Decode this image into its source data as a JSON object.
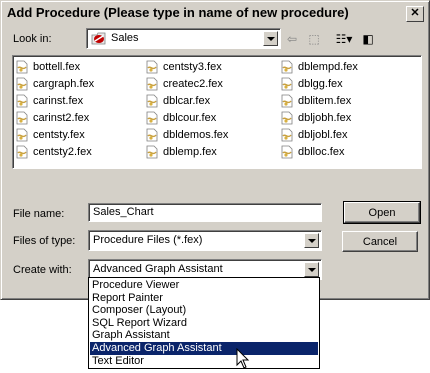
{
  "window": {
    "title": "Add Procedure (Please type in name of new procedure)",
    "close_symbol": "✕"
  },
  "look_in": {
    "label": "Look in:",
    "value": "Sales"
  },
  "toolbar": {
    "back_symbol": "⇦",
    "up_symbol": "⬚",
    "view_symbol": "☷▾",
    "detail_symbol": "◧"
  },
  "files": [
    "bottell.fex",
    "cargraph.fex",
    "carinst.fex",
    "carinst2.fex",
    "centsty.fex",
    "centsty2.fex",
    "centsty3.fex",
    "createc2.fex",
    "dblcar.fex",
    "dblcour.fex",
    "dbldemos.fex",
    "dblemp.fex",
    "dblempd.fex",
    "dblgg.fex",
    "dblitem.fex",
    "dbljobh.fex",
    "dbljobl.fex",
    "dblloc.fex"
  ],
  "file_name": {
    "label": "File name:",
    "value": "Sales_Chart"
  },
  "files_of_type": {
    "label": "Files of type:",
    "value": "Procedure Files (*.fex)"
  },
  "create_with": {
    "label": "Create with:",
    "value": "Advanced Graph Assistant",
    "options": [
      "Procedure Viewer",
      "Report Painter",
      "Composer (Layout)",
      "SQL Report Wizard",
      "Graph Assistant",
      "Advanced Graph Assistant",
      "Text Editor"
    ],
    "selected_index": 5
  },
  "buttons": {
    "open": "Open",
    "cancel": "Cancel"
  },
  "colors": {
    "face": "#d4d0c8",
    "highlight": "#0a246a",
    "folder_red": "#c00000"
  }
}
